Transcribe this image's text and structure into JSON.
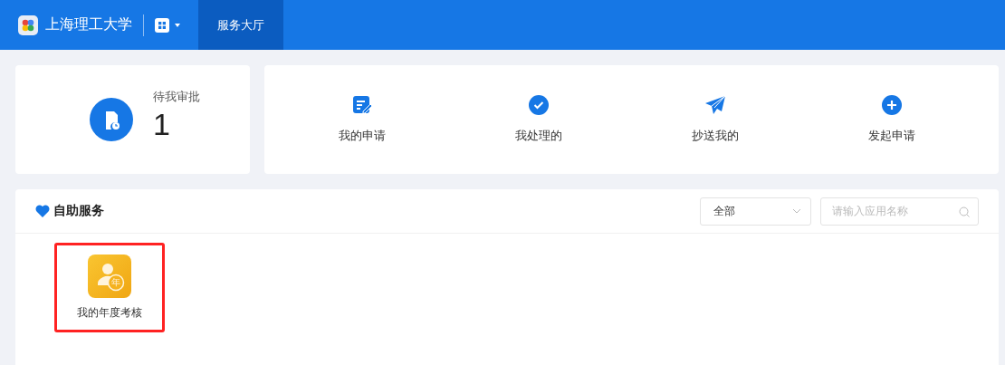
{
  "header": {
    "title": "上海理工大学",
    "tabs": [
      {
        "label": "服务大厅",
        "selected": true
      }
    ]
  },
  "pending": {
    "label": "待我审批",
    "count": "1"
  },
  "actions": [
    {
      "label": "我的申请"
    },
    {
      "label": "我处理的"
    },
    {
      "label": "抄送我的"
    },
    {
      "label": "发起申请"
    }
  ],
  "services": {
    "title": "自助服务",
    "filter": {
      "value": "全部"
    },
    "search": {
      "placeholder": "请输入应用名称"
    },
    "apps": [
      {
        "label": "我的年度考核",
        "badge": "年",
        "highlighted": true
      }
    ]
  }
}
